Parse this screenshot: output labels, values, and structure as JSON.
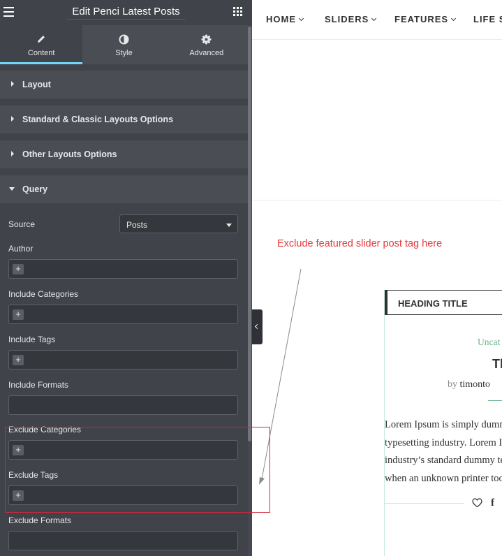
{
  "panel": {
    "title": "Edit Penci Latest Posts",
    "tabs": [
      {
        "label": "Content",
        "icon": "pencil-icon"
      },
      {
        "label": "Style",
        "icon": "contrast-icon"
      },
      {
        "label": "Advanced",
        "icon": "gear-icon"
      }
    ],
    "sections": {
      "layout": "Layout",
      "standard": "Standard & Classic Layouts Options",
      "other": "Other Layouts Options",
      "query": "Query"
    },
    "query": {
      "source_label": "Source",
      "source_value": "Posts",
      "author_label": "Author",
      "include_categories_label": "Include Categories",
      "include_tags_label": "Include Tags",
      "include_formats_label": "Include Formats",
      "exclude_categories_label": "Exclude Categories",
      "exclude_tags_label": "Exclude Tags",
      "exclude_formats_label": "Exclude Formats",
      "plus_symbol": "+"
    }
  },
  "preview": {
    "nav": [
      "HOME",
      "SLIDERS",
      "FEATURES",
      "LIFE S"
    ],
    "annotation": "Exclude featured slider post tag here",
    "widget": {
      "heading": "HEADING TITLE",
      "category": "Uncat",
      "title": "Th",
      "author_prefix": "by",
      "author": "timonto",
      "excerpt_lines": [
        "Lorem Ipsum is simply dummy text of the",
        "typesetting industry. Lorem Ipsum has been",
        "industry’s standard dummy text ever since the",
        "when an unknown printer took a galley of type"
      ],
      "share_icons": [
        "heart-icon",
        "facebook-icon"
      ]
    }
  },
  "colors": {
    "panel_bg": "#404349",
    "active_tab_accent": "#71d7f7",
    "highlight_red": "#d6253a",
    "annotation_red": "#e5383b",
    "category_green": "#6eb48c"
  }
}
